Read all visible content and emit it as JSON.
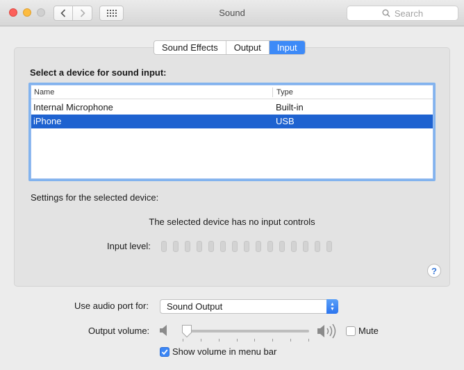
{
  "window": {
    "title": "Sound"
  },
  "search": {
    "placeholder": "Search"
  },
  "tabs": [
    {
      "label": "Sound Effects",
      "active": false
    },
    {
      "label": "Output",
      "active": false
    },
    {
      "label": "Input",
      "active": true
    }
  ],
  "input": {
    "heading": "Select a device for sound input:",
    "columns": [
      "Name",
      "Type"
    ],
    "devices": [
      {
        "name": "Internal Microphone",
        "type": "Built-in",
        "selected": false
      },
      {
        "name": "iPhone",
        "type": "USB",
        "selected": true
      }
    ],
    "settings_label": "Settings for the selected device:",
    "no_controls": "The selected device has no input controls",
    "input_level_label": "Input level:",
    "input_level_segments": 15,
    "input_level_value": 0,
    "help": "?"
  },
  "bottom": {
    "audio_port_label": "Use audio port for:",
    "audio_port_value": "Sound Output",
    "output_volume_label": "Output volume:",
    "output_volume_value": 0.0,
    "mute_label": "Mute",
    "mute_checked": false,
    "show_volume_label": "Show volume in menu bar",
    "show_volume_checked": true
  },
  "colors": {
    "accent": "#3d8af7",
    "selection": "#1e62d0",
    "close": "#fc605b",
    "minimize": "#fdbc40"
  },
  "icons": {
    "back": "chevron-left-icon",
    "forward": "chevron-right-icon",
    "show_all": "grid-icon",
    "search": "magnifier-icon",
    "speaker_low": "speaker-low-icon",
    "speaker_high": "speaker-high-icon",
    "help": "question-mark-icon"
  }
}
